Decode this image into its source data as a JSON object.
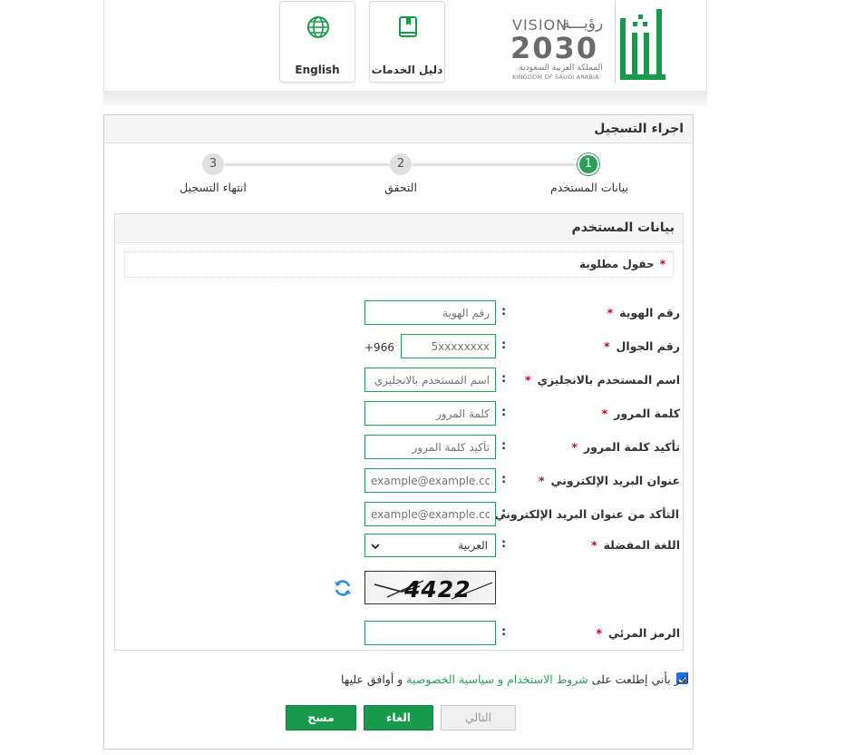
{
  "header": {
    "vision": {
      "word": "VISION",
      "arabic": "رؤيـــة",
      "year": "2030",
      "subtitle_ar": "المملكة العربية السعودية",
      "subtitle_en": "KINGDOM OF SAUDI ARABIA"
    },
    "services_guide_label": "دليل الخدمات",
    "english_label": "English"
  },
  "panel": {
    "title": "اجراء التسجيل"
  },
  "wizard": {
    "steps": [
      {
        "number": "1",
        "label": "بيانات المستخدم",
        "active": true
      },
      {
        "number": "2",
        "label": "التحقق",
        "active": false
      },
      {
        "number": "3",
        "label": "انتهاء التسجيل",
        "active": false
      }
    ]
  },
  "form": {
    "section_title": "بيانات المستخدم",
    "required_note": "حقول مطلوبة",
    "fields": {
      "id_number": {
        "label": "رقم الهوية",
        "placeholder": "رقم الهوية"
      },
      "mobile": {
        "label": "رقم الجوال",
        "placeholder": "5xxxxxxxx",
        "country_code": "+966"
      },
      "username_en": {
        "label": "اسم المستخدم بالانجليزي",
        "placeholder": "اسم المستخدم بالانجليزي"
      },
      "password": {
        "label": "كلمة المرور",
        "placeholder": "كلمة المرور"
      },
      "confirm_password": {
        "label": "تأكيد كلمة المرور",
        "placeholder": "تأكيد كلمة المرور"
      },
      "email": {
        "label": "عنوان البريد الإلكتروني",
        "placeholder": "example@example.com"
      },
      "confirm_email": {
        "label": "التأكد من عنوان البريد الإلكتروني",
        "placeholder": "example@example.com"
      },
      "language": {
        "label": "اللغة المفضلة",
        "value": "العربية"
      },
      "captcha": {
        "label": "الرمز المرئي",
        "image_text": "4422",
        "value": ""
      }
    },
    "colon": ":",
    "star": "*"
  },
  "agreement": {
    "prefix": "أقر بأني إطلعت على",
    "terms_link": "شروط الاستخدام",
    "and": "و",
    "privacy_link": "سياسية الخصوصية",
    "suffix": "و أوافق عليها",
    "checked": true
  },
  "buttons": {
    "next": "التالي",
    "cancel": "الغاء",
    "clear": "مسح"
  },
  "colors": {
    "brand_green": "#179a4b",
    "active_step": "#2d9f5b",
    "required_star": "#d0021b"
  },
  "icons": {
    "guide": "book-icon",
    "english": "globe-icon",
    "refresh": "refresh-icon",
    "select": "chevron-down-icon"
  }
}
